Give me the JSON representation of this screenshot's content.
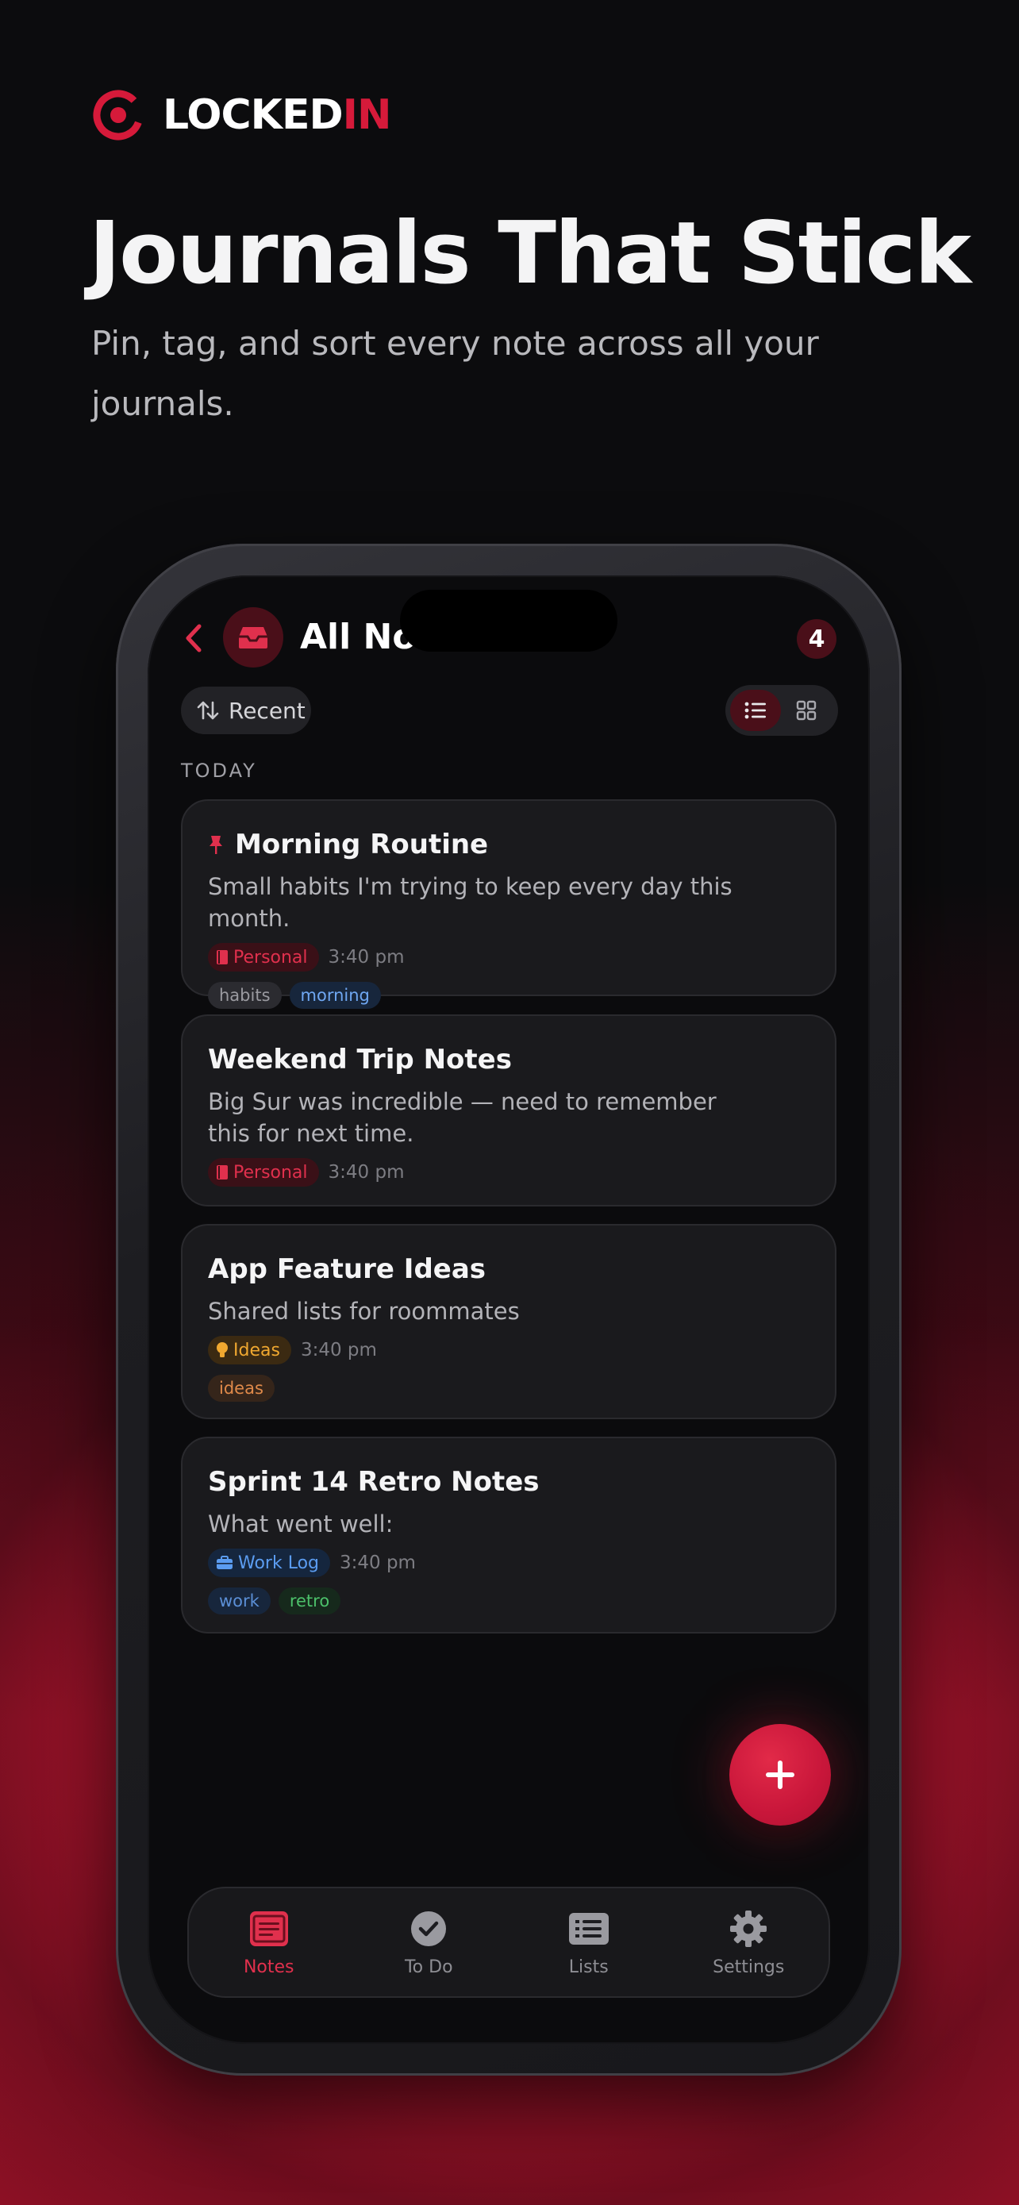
{
  "brand": {
    "name_part1": "LOCKED",
    "name_part2": "IN"
  },
  "hero": {
    "title": "Journals That Stick",
    "subtitle": "Pin, tag, and sort every note across all your journals."
  },
  "screen": {
    "title": "All Notes",
    "count": "4",
    "sort_label": "Recent",
    "section": "TODAY"
  },
  "notes": [
    {
      "title": "Morning Routine",
      "pinned": true,
      "body": "Small habits I'm trying to keep every day this month.",
      "journal": "Personal",
      "time": "3:40 pm",
      "tags": [
        "habits",
        "morning"
      ]
    },
    {
      "title": "Weekend Trip Notes",
      "pinned": false,
      "body": "Big Sur was incredible — need to remember this for next time.",
      "journal": "Personal",
      "time": "3:40 pm",
      "tags": []
    },
    {
      "title": "App Feature Ideas",
      "pinned": false,
      "body": "Shared lists for roommates",
      "journal": "Ideas",
      "time": "3:40 pm",
      "tags": [
        "ideas"
      ]
    },
    {
      "title": "Sprint 14 Retro Notes",
      "pinned": false,
      "body": "What went well:",
      "journal": "Work Log",
      "time": "3:40 pm",
      "tags": [
        "work",
        "retro"
      ]
    }
  ],
  "tabs": [
    {
      "label": "Notes",
      "icon": "notes-icon",
      "active": true
    },
    {
      "label": "To Do",
      "icon": "check-circle-icon",
      "active": false
    },
    {
      "label": "Lists",
      "icon": "list-icon",
      "active": false
    },
    {
      "label": "Settings",
      "icon": "gear-icon",
      "active": false
    }
  ],
  "colors": {
    "accent": "#d61a3a",
    "background": "#0c0c0e",
    "card": "#1a1a1d",
    "personal": "#e0304d",
    "ideas": "#f0a830",
    "work": "#5b9cf0",
    "retro": "#4cc06a"
  }
}
